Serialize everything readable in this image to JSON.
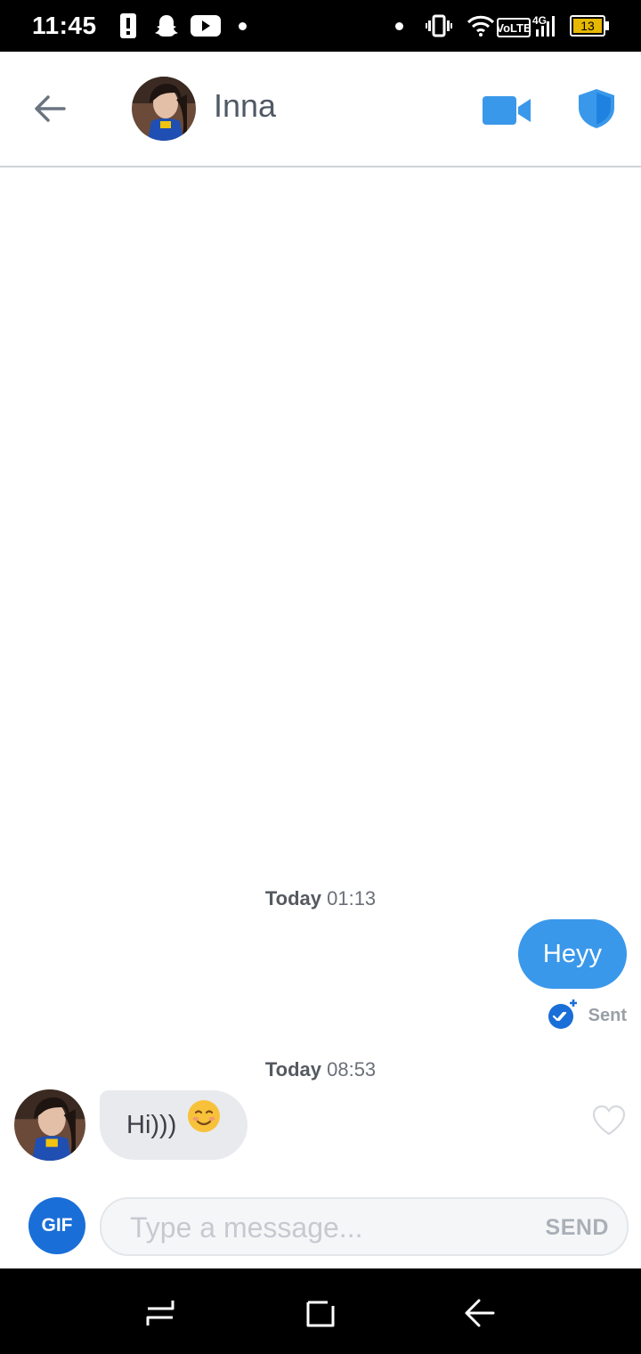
{
  "status_bar": {
    "time": "11:45",
    "left_icons": [
      "alert-icon",
      "snapchat-icon",
      "youtube-icon",
      "dot-icon"
    ],
    "right_icons": [
      "dot-icon",
      "vibrate-icon",
      "wifi-icon",
      "volte-4g-signal-icon",
      "battery-icon"
    ],
    "volte": "VoLTE",
    "network": "4G",
    "battery": "13"
  },
  "header": {
    "contact_name": "Inna",
    "icons": [
      "back-arrow-icon",
      "video-call-icon",
      "shield-icon"
    ],
    "accent": "#3a98ea"
  },
  "conversation": {
    "stamp1_day": "Today",
    "stamp1_time": "01:13",
    "outgoing_text": "Heyy",
    "outgoing_status": "Sent",
    "stamp2_day": "Today",
    "stamp2_time": "08:53",
    "incoming_text": "Hi)))",
    "incoming_emoji": "😊"
  },
  "composer": {
    "gif_label": "GIF",
    "placeholder": "Type a message...",
    "send_label": "SEND"
  },
  "nav_bar": {
    "icons": [
      "recents-icon",
      "home-icon",
      "back-icon"
    ]
  },
  "colors": {
    "bubble_out": "#3a98ea",
    "bubble_in": "#e9eaee",
    "gif_button": "#1a6ed8"
  }
}
